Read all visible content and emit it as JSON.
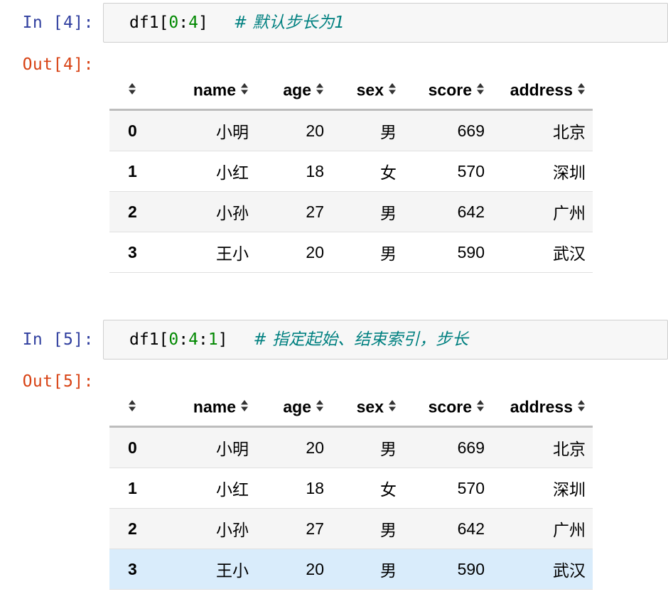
{
  "cells": [
    {
      "in_prompt": "In [4]:",
      "out_prompt": "Out[4]:",
      "code": {
        "prefix": "df1[",
        "n1": "0",
        "colon1": ":",
        "n2": "4",
        "n3": "",
        "colon2": "",
        "suffix": "]",
        "comment": "# 默认步长为1"
      },
      "highlight_row": -1
    },
    {
      "in_prompt": "In [5]:",
      "out_prompt": "Out[5]:",
      "code": {
        "prefix": "df1[",
        "n1": "0",
        "colon1": ":",
        "n2": "4",
        "colon2": ":",
        "n3": "1",
        "suffix": "]",
        "comment": "# 指定起始、结束索引，步长"
      },
      "highlight_row": 3
    }
  ],
  "table": {
    "columns": [
      "name",
      "age",
      "sex",
      "score",
      "address"
    ],
    "rows": [
      {
        "index": "0",
        "values": [
          "小明",
          "20",
          "男",
          "669",
          "北京"
        ]
      },
      {
        "index": "1",
        "values": [
          "小红",
          "18",
          "女",
          "570",
          "深圳"
        ]
      },
      {
        "index": "2",
        "values": [
          "小孙",
          "27",
          "男",
          "642",
          "广州"
        ]
      },
      {
        "index": "3",
        "values": [
          "王小",
          "20",
          "男",
          "590",
          "武汉"
        ]
      }
    ]
  },
  "icons": {
    "sort": "sort-arrows-icon"
  }
}
